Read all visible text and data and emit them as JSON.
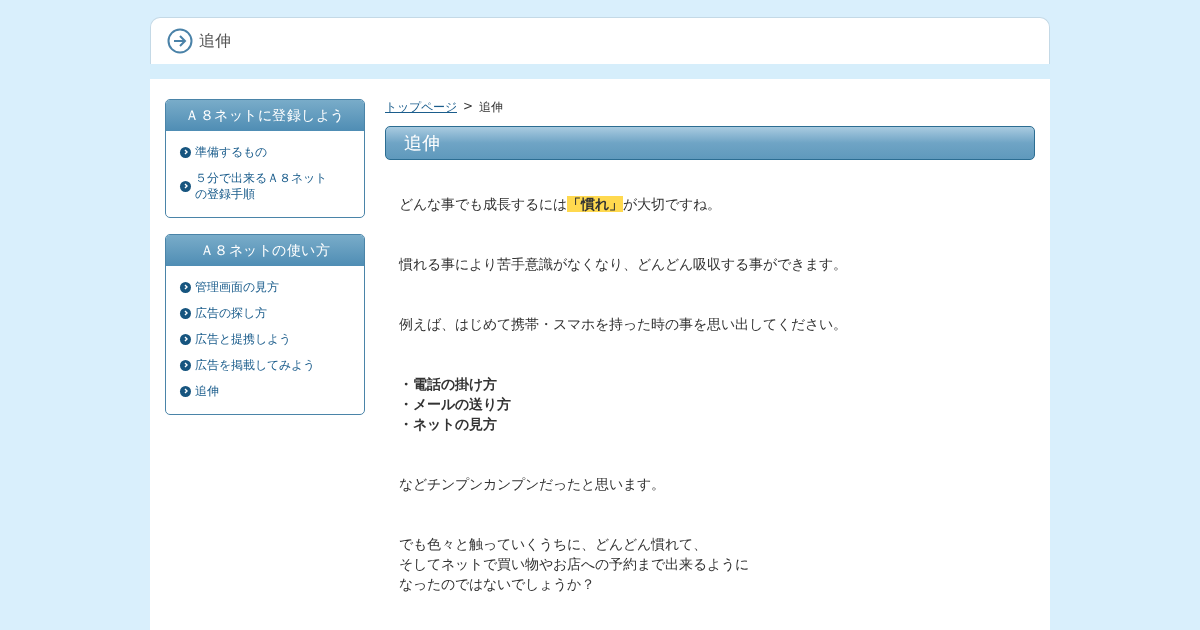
{
  "header": {
    "title": "追伸"
  },
  "sidebar": [
    {
      "title": "Ａ８ネットに登録しよう",
      "items": [
        {
          "label": "準備するもの"
        },
        {
          "label": "５分で出来るＡ８ネットの登録手順"
        }
      ]
    },
    {
      "title": "Ａ８ネットの使い方",
      "items": [
        {
          "label": "管理画面の見方"
        },
        {
          "label": "広告の探し方"
        },
        {
          "label": "広告と提携しよう"
        },
        {
          "label": "広告を掲載してみよう"
        },
        {
          "label": "追伸"
        }
      ]
    }
  ],
  "breadcrumb": {
    "link": "トップページ",
    "separator": ">",
    "current": "追伸"
  },
  "article": {
    "title": "追伸",
    "blocks": [
      {
        "kind": "text",
        "lines": [
          [
            {
              "text": "どんな事でも成長するには",
              "highlight": false
            },
            {
              "text": "「慣れ」",
              "highlight": true
            },
            {
              "text": "が大切ですね。",
              "highlight": false
            }
          ]
        ]
      },
      {
        "kind": "text",
        "lines": [
          [
            {
              "text": "慣れる事により苦手意識がなくなり、どんどん吸収する事ができます。",
              "highlight": false
            }
          ]
        ]
      },
      {
        "kind": "text",
        "lines": [
          [
            {
              "text": "例えば、はじめて携帯・スマホを持った時の事を思い出してください。",
              "highlight": false
            }
          ]
        ]
      },
      {
        "kind": "list",
        "lines": [
          "・電話の掛け方",
          "・メールの送り方",
          "・ネットの見方"
        ]
      },
      {
        "kind": "text",
        "lines": [
          [
            {
              "text": "などチンプンカンプンだったと思います。",
              "highlight": false
            }
          ]
        ]
      },
      {
        "kind": "text",
        "lines": [
          [
            {
              "text": "でも色々と触っていくうちに、どんどん慣れて、",
              "highlight": false
            }
          ],
          [
            {
              "text": "そしてネットで買い物やお店への予約まで出来るように",
              "highlight": false
            }
          ],
          [
            {
              "text": "なったのではないでしょうか？",
              "highlight": false
            }
          ]
        ]
      }
    ]
  }
}
